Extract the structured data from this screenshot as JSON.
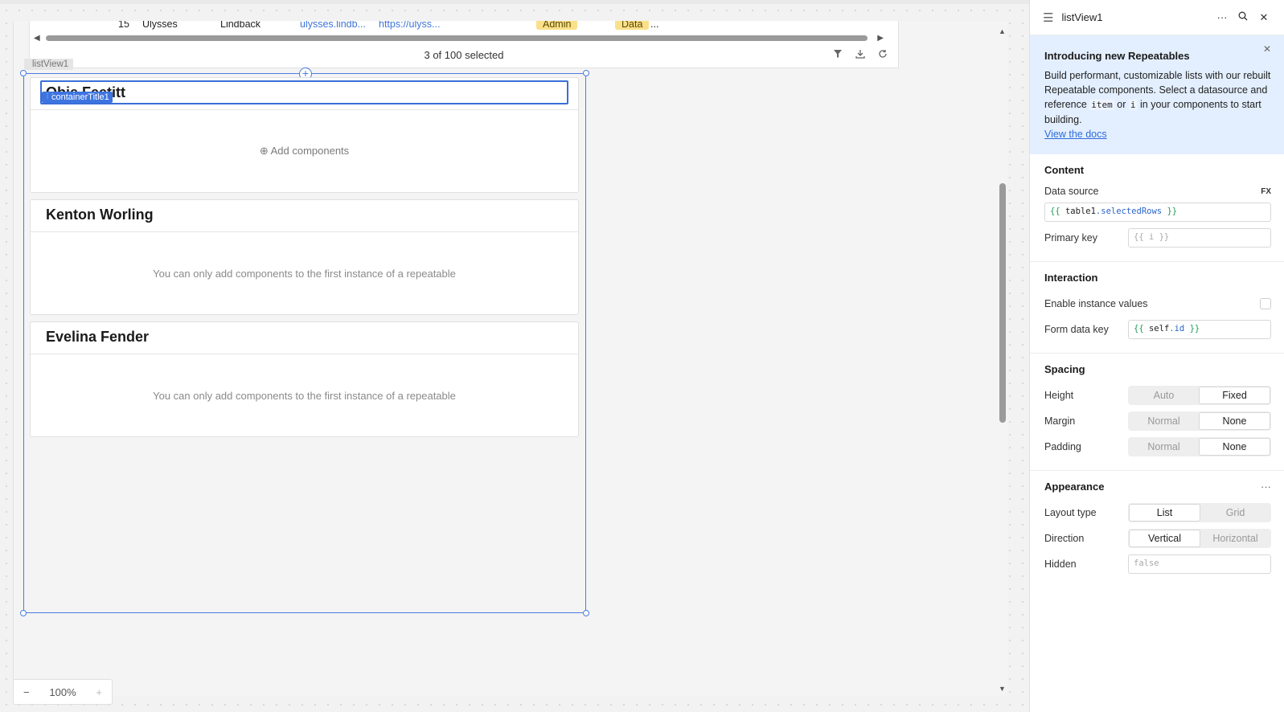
{
  "canvas": {
    "table": {
      "peek_row": {
        "num": "15",
        "first": "Ulysses",
        "last": "Lindback",
        "email": "ulysses.lindb...",
        "url": "https://ulyss...",
        "role": "Admin",
        "team": "Data",
        "more": "..."
      },
      "footer_text": "3 of 100 selected",
      "icons": [
        "filter-icon",
        "download-icon",
        "refresh-icon"
      ]
    },
    "listview": {
      "label": "listView1",
      "title_badge": "containerTitle1",
      "cards": [
        {
          "title": "Obie Feetitt",
          "body": "Add components"
        },
        {
          "title": "Kenton Worling",
          "body": "You can only add components to the first instance of a repeatable"
        },
        {
          "title": "Evelina Fender",
          "body": "You can only add components to the first instance of a repeatable"
        }
      ]
    },
    "zoom": {
      "minus": "−",
      "level": "100%",
      "plus": "+"
    }
  },
  "inspector": {
    "title": "listView1",
    "banner": {
      "heading": "Introducing new Repeatables",
      "text_1": "Build performant, customizable lists with our rebuilt Repeatable components. Select a datasource and reference",
      "code_item": "item",
      "or": "or",
      "code_i": "i",
      "text_2": "in your components to start building.",
      "link": "View the docs"
    },
    "content": {
      "heading": "Content",
      "data_source_label": "Data source",
      "fx": "FX",
      "data_source_open": "{{",
      "data_source_obj": "table1",
      "data_source_prop": ".selectedRows",
      "data_source_close": "}}",
      "primary_key_label": "Primary key",
      "primary_key_placeholder": "{{ i }}"
    },
    "interaction": {
      "heading": "Interaction",
      "enable_label": "Enable instance values",
      "form_key_label": "Form data key",
      "form_key_open": "{{",
      "form_key_obj": "self",
      "form_key_prop": ".id",
      "form_key_close": "}}"
    },
    "spacing": {
      "heading": "Spacing",
      "rows": [
        {
          "label": "Height",
          "options": [
            "Auto",
            "Fixed"
          ],
          "selected": 1
        },
        {
          "label": "Margin",
          "options": [
            "Normal",
            "None"
          ],
          "selected": 1
        },
        {
          "label": "Padding",
          "options": [
            "Normal",
            "None"
          ],
          "selected": 1
        }
      ]
    },
    "appearance": {
      "heading": "Appearance",
      "more": "···",
      "layout_label": "Layout type",
      "layout_options": [
        "List",
        "Grid"
      ],
      "direction_label": "Direction",
      "direction_options": [
        "Vertical",
        "Horizontal"
      ],
      "hidden_label": "Hidden",
      "hidden_placeholder": "false"
    }
  },
  "colors": {
    "accent": "#3d74e0",
    "banner_bg": "#e3efff",
    "code_green": "#1f9d55"
  }
}
